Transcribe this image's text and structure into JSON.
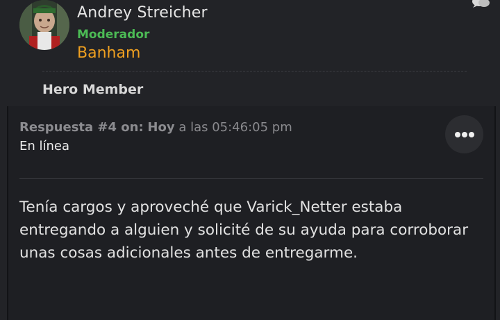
{
  "profile": {
    "username": "Andrey Streicher",
    "role": "Moderador",
    "group": "Banham",
    "rank": "Hero Member",
    "avatar_icon": "user-avatar"
  },
  "post": {
    "reply_label": "Respuesta #4 on:",
    "day": "Hoy",
    "time_text": "a las 05:46:05 pm",
    "status": "En línea",
    "body": "Tenía cargos y aproveché que Varick_Netter estaba entregando a alguien y solicité de su ayuda para corroborar unas cosas adicionales antes de entregarme."
  },
  "icons": {
    "more": "more-horizontal-icon",
    "chat": "chat-bubbles-icon"
  },
  "colors": {
    "background": "#222327",
    "role": "#4cbb55",
    "group": "#f0a020"
  }
}
